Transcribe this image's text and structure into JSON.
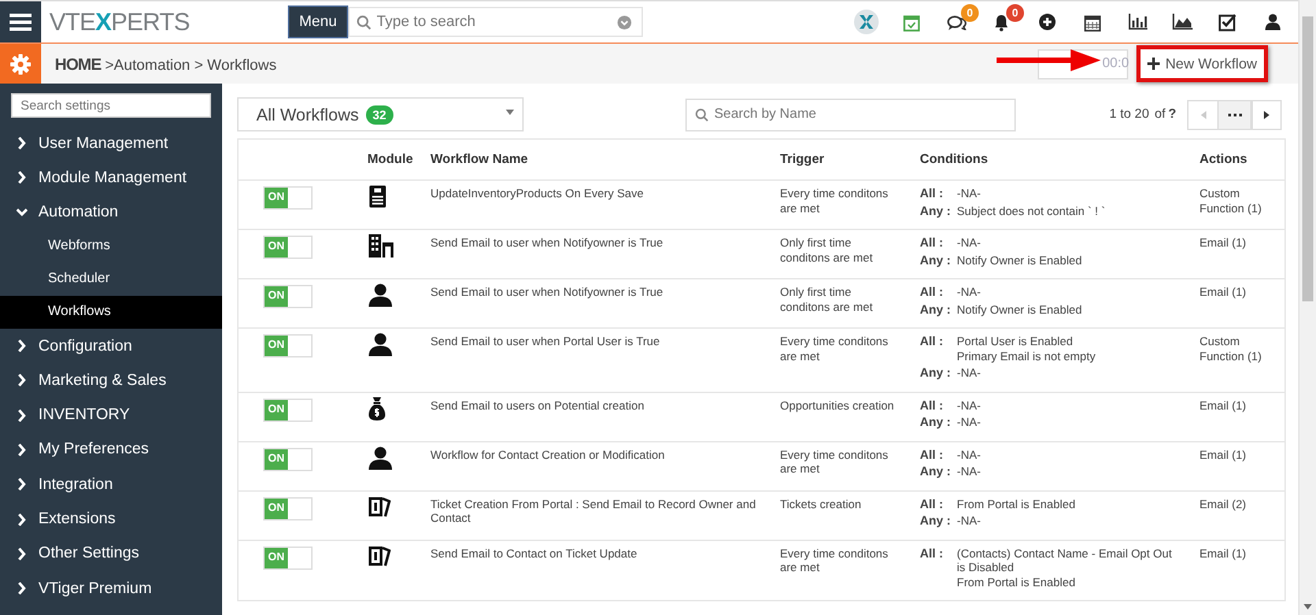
{
  "logo": [
    {
      "text": "VTE",
      "accent": false
    },
    {
      "text": "X",
      "accent": true
    },
    {
      "text": "PERTS",
      "accent": false
    }
  ],
  "menu_button": "Menu",
  "global_search": {
    "placeholder": "Type to search"
  },
  "top_icons": [
    {
      "kind": "xlogo"
    },
    {
      "kind": "calendar-check"
    },
    {
      "kind": "chat",
      "badge": "0",
      "color": "#f0901c"
    },
    {
      "kind": "bell",
      "badge": "0",
      "color": "#e0452f"
    },
    {
      "kind": "plus"
    },
    {
      "kind": "calendar"
    },
    {
      "kind": "bars"
    },
    {
      "kind": "area"
    },
    {
      "kind": "checkbox"
    },
    {
      "kind": "user"
    }
  ],
  "breadcrumb": [
    "HOME",
    ">Automation >",
    "Workflows"
  ],
  "timer_button": "00:0",
  "new_workflow_button": "New Workflow",
  "sidebar": {
    "search": {
      "placeholder": "Search settings"
    },
    "items": [
      {
        "label": "User Management",
        "expanded": false
      },
      {
        "label": "Module Management",
        "expanded": false
      },
      {
        "label": "Automation",
        "expanded": true,
        "children": [
          {
            "label": "Webforms",
            "selected": false
          },
          {
            "label": "Scheduler",
            "selected": false
          },
          {
            "label": "Workflows",
            "selected": true
          }
        ]
      },
      {
        "label": "Configuration",
        "expanded": false
      },
      {
        "label": "Marketing & Sales",
        "expanded": false
      },
      {
        "label": "INVENTORY",
        "expanded": false
      },
      {
        "label": "My Preferences",
        "expanded": false
      },
      {
        "label": "Integration",
        "expanded": false
      },
      {
        "label": "Extensions",
        "expanded": false
      },
      {
        "label": "Other Settings",
        "expanded": false
      },
      {
        "label": "VTiger Premium",
        "expanded": false
      }
    ]
  },
  "filter": {
    "label": "All Workflows",
    "count": "32"
  },
  "name_search": {
    "placeholder": "Search by Name"
  },
  "pagination": {
    "range": "1 to 20",
    "of": "of",
    "total": "?"
  },
  "table": {
    "columns": [
      "Module",
      "Workflow Name",
      "Trigger",
      "Conditions",
      "Actions"
    ],
    "rows": [
      {
        "on": true,
        "toggle": "ON",
        "kind": "document",
        "name": "UpdateInventoryProducts On Every Save",
        "trigger": "Every time conditons are met",
        "conditions": [
          {
            "label": "All :",
            "values": [
              "-NA-"
            ]
          },
          {
            "label": "Any :",
            "values": [
              "Subject does not contain ` ! `"
            ]
          }
        ],
        "actions": "Custom Function (1)"
      },
      {
        "on": true,
        "toggle": "ON",
        "kind": "building",
        "name": "Send Email to user when Notifyowner is True",
        "trigger": "Only first time conditons are met",
        "conditions": [
          {
            "label": "All :",
            "values": [
              "-NA-"
            ]
          },
          {
            "label": "Any :",
            "values": [
              "Notify Owner is Enabled"
            ]
          }
        ],
        "actions": "Email (1)"
      },
      {
        "on": true,
        "toggle": "ON",
        "kind": "person",
        "name": "Send Email to user when Notifyowner is True",
        "trigger": "Only first time conditons are met",
        "conditions": [
          {
            "label": "All :",
            "values": [
              "-NA-"
            ]
          },
          {
            "label": "Any :",
            "values": [
              "Notify Owner is Enabled"
            ]
          }
        ],
        "actions": "Email (1)"
      },
      {
        "on": true,
        "toggle": "ON",
        "kind": "person",
        "name": "Send Email to user when Portal User is True",
        "trigger": "Every time conditons are met",
        "conditions": [
          {
            "label": "All :",
            "values": [
              "Portal User is Enabled",
              "Primary Email is not empty"
            ]
          },
          {
            "label": "Any :",
            "values": [
              "-NA-"
            ]
          }
        ],
        "actions": "Custom Function (1)"
      },
      {
        "on": true,
        "toggle": "ON",
        "kind": "moneybag",
        "name": "Send Email to users on Potential creation",
        "trigger": "Opportunities creation",
        "conditions": [
          {
            "label": "All :",
            "values": [
              "-NA-"
            ]
          },
          {
            "label": "Any :",
            "values": [
              "-NA-"
            ]
          }
        ],
        "actions": "Email (1)"
      },
      {
        "on": true,
        "toggle": "ON",
        "kind": "person",
        "name": "Workflow for Contact Creation or Modification",
        "trigger": "Every time conditons are met",
        "conditions": [
          {
            "label": "All :",
            "values": [
              "-NA-"
            ]
          },
          {
            "label": "Any :",
            "values": [
              "-NA-"
            ]
          }
        ],
        "actions": "Email (1)"
      },
      {
        "on": true,
        "toggle": "ON",
        "kind": "ticket",
        "name": "Ticket Creation From Portal : Send Email to Record Owner and Contact",
        "trigger": "Tickets creation",
        "conditions": [
          {
            "label": "All :",
            "values": [
              "From Portal is Enabled"
            ]
          },
          {
            "label": "Any :",
            "values": [
              "-NA-"
            ]
          }
        ],
        "actions": "Email (2)"
      },
      {
        "on": true,
        "toggle": "ON",
        "kind": "ticket",
        "name": "Send Email to Contact on Ticket Update",
        "trigger": "Every time conditons are met",
        "conditions": [
          {
            "label": "All :",
            "values": [
              "(Contacts) Contact Name - Email Opt Out is Disabled",
              "From Portal is Enabled"
            ]
          }
        ],
        "actions": "Email (1)"
      }
    ]
  }
}
